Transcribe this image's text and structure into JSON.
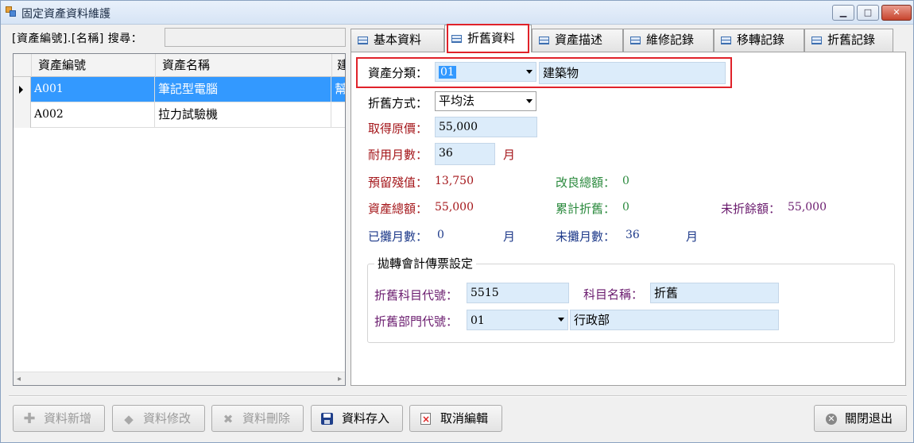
{
  "window": {
    "title": "固定資產資料維護"
  },
  "search": {
    "label": "[資產編號].[名稱] 搜尋：",
    "value": ""
  },
  "grid": {
    "columns": [
      "資產編號",
      "資產名稱",
      "建"
    ],
    "rows": [
      {
        "code": "A001",
        "name": "筆記型電腦",
        "extra": "幫",
        "selected": true
      },
      {
        "code": "A002",
        "name": "拉力試驗機",
        "extra": "",
        "selected": false
      }
    ]
  },
  "tabs": [
    "基本資料",
    "折舊資料",
    "資產描述",
    "維修記錄",
    "移轉記錄",
    "折舊記錄"
  ],
  "active_tab": "折舊資料",
  "form": {
    "asset_category_label": "資產分類：",
    "asset_category_code": "01",
    "asset_category_name": "建築物",
    "method_label": "折舊方式：",
    "method_value": "平均法",
    "cost_label": "取得原價：",
    "cost_value": "55,000",
    "life_label": "耐用月數：",
    "life_value": "36",
    "life_unit": "月",
    "residual_label": "預留殘值：",
    "residual_value": "13,750",
    "improve_label": "改良總額：",
    "improve_value": "0",
    "total_label": "資產總額：",
    "total_value": "55,000",
    "accum_label": "累計折舊：",
    "accum_value": "0",
    "undep_label": "未折餘額：",
    "undep_value": "55,000",
    "amort_label": "已攤月數：",
    "amort_value": "0",
    "amort_unit": "月",
    "remain_label": "未攤月數：",
    "remain_value": "36",
    "remain_unit": "月"
  },
  "journal": {
    "title": "拋轉會計傳票設定",
    "account_code_label": "折舊科目代號：",
    "account_code": "5515",
    "account_name_label": "科目名稱：",
    "account_name": "折舊",
    "dept_label": "折舊部門代號：",
    "dept_code": "01",
    "dept_name": "行政部"
  },
  "buttons": {
    "add": "資料新增",
    "edit": "資料修改",
    "delete": "資料刪除",
    "save": "資料存入",
    "cancel": "取消編輯",
    "exit": "關閉退出"
  },
  "colors": {
    "selection": "#3399ff",
    "field_bg": "#dcecfa",
    "highlight_box": "#e0222a",
    "label_red": "#a4161a",
    "label_green": "#2b8a3e",
    "label_purple": "#6a1b6e",
    "label_navy": "#1e3a8a"
  }
}
